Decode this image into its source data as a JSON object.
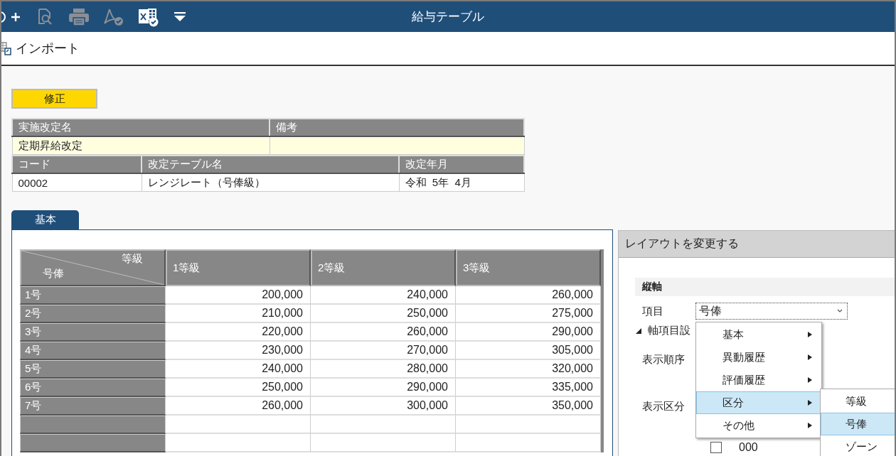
{
  "window": {
    "title": "給与テーブル"
  },
  "toolbar": {
    "import_label": "インポート"
  },
  "edit_button": "修正",
  "info_top": [
    {
      "label": "実施改定名",
      "value": "定期昇給改定"
    },
    {
      "label": "備考"
    }
  ],
  "info_bottom": [
    {
      "label": "コード",
      "value": "00002"
    },
    {
      "label": "改定テーブル名",
      "value": "レンジレート（号俸級）"
    },
    {
      "label": "改定年月",
      "value": "令和  5年  4月"
    }
  ],
  "tabs": [
    {
      "label": "基本",
      "selected": true
    }
  ],
  "grid": {
    "corner_column": "等級",
    "corner_row": "号俸",
    "columns": [
      "1等級",
      "2等級",
      "3等級"
    ],
    "rows": [
      {
        "label": "1号",
        "values": [
          "200,000",
          "240,000",
          "260,000"
        ]
      },
      {
        "label": "2号",
        "values": [
          "210,000",
          "250,000",
          "275,000"
        ]
      },
      {
        "label": "3号",
        "values": [
          "220,000",
          "260,000",
          "290,000"
        ]
      },
      {
        "label": "4号",
        "values": [
          "230,000",
          "270,000",
          "305,000"
        ]
      },
      {
        "label": "5号",
        "values": [
          "240,000",
          "280,000",
          "320,000"
        ]
      },
      {
        "label": "6号",
        "values": [
          "250,000",
          "290,000",
          "335,000"
        ]
      },
      {
        "label": "7号",
        "values": [
          "260,000",
          "300,000",
          "350,000"
        ]
      }
    ]
  },
  "layout_panel": {
    "title": "レイアウトを変更する",
    "section": "縦軸",
    "item_label": "項目",
    "item_value": "号俸",
    "subsection": "軸項目設",
    "expanded": true,
    "order_label": "表示順序",
    "division_label": "表示区分",
    "list_rows": [
      {
        "checked": false,
        "code": "000"
      }
    ]
  },
  "menu": [
    {
      "label": "基本",
      "selected": false
    },
    {
      "label": "異動履歴",
      "selected": false
    },
    {
      "label": "評価履歴",
      "selected": false
    },
    {
      "label": "区分",
      "selected": true
    },
    {
      "label": "その他",
      "selected": false
    }
  ],
  "submenu": [
    {
      "label": "等級",
      "selected": false
    },
    {
      "label": "号俸",
      "selected": true
    },
    {
      "label": "ゾーン",
      "selected": false
    }
  ]
}
